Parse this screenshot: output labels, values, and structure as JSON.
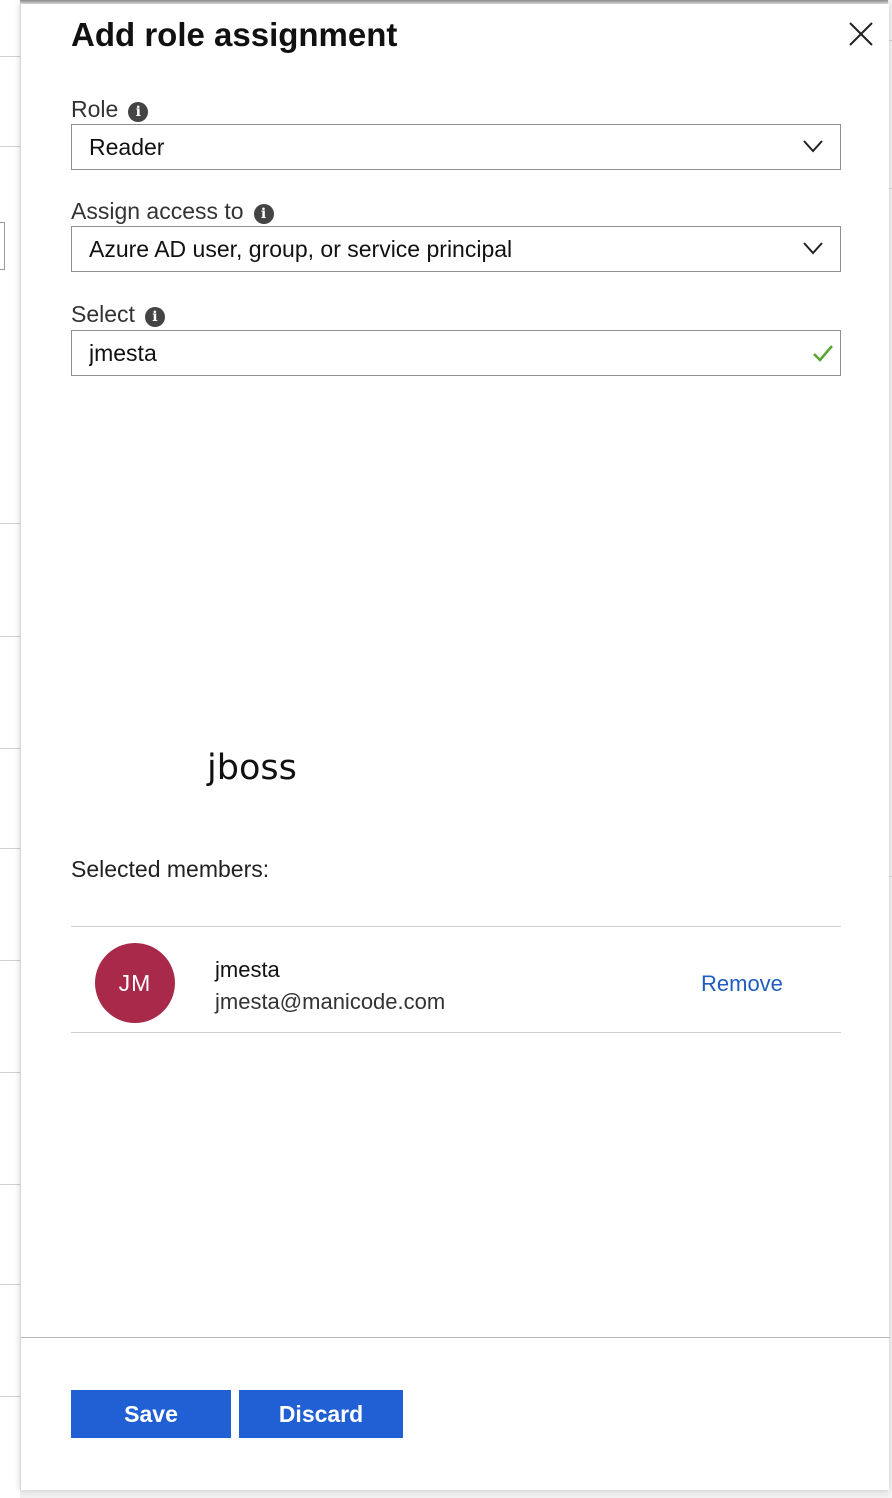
{
  "panel": {
    "title": "Add role assignment",
    "close_icon": "close-icon"
  },
  "role": {
    "label": "Role",
    "value": "Reader",
    "icon": "info-icon"
  },
  "assign_access": {
    "label": "Assign access to",
    "value": "Azure AD user, group, or service principal",
    "icon": "info-icon"
  },
  "select": {
    "label": "Select",
    "value": "jmesta",
    "status_icon": "checkmark-icon",
    "status_color": "#5aa532"
  },
  "search_result": {
    "text": "jboss"
  },
  "selected_members": {
    "label": "Selected members:",
    "items": [
      {
        "initials": "JM",
        "name": "jmesta",
        "email": "jmesta@manicode.com",
        "remove_label": "Remove",
        "avatar_color": "#a8294a"
      }
    ]
  },
  "footer": {
    "save_label": "Save",
    "discard_label": "Discard",
    "button_color": "#2160d4"
  }
}
